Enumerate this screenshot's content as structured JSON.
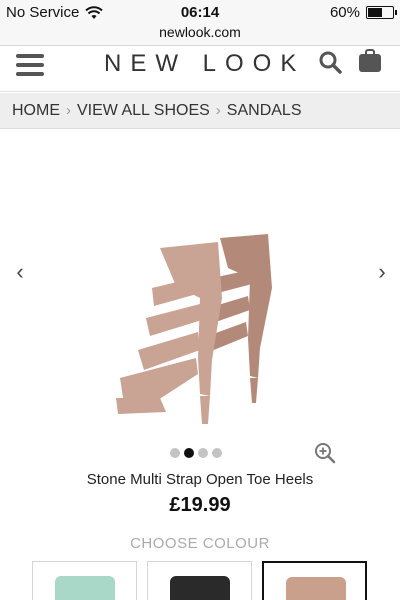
{
  "status_bar": {
    "carrier": "No Service",
    "time": "06:14",
    "battery": "60%",
    "battery_level": 0.6,
    "icons": {
      "wifi": "wifi-icon",
      "battery": "battery-icon"
    }
  },
  "browser": {
    "url": "newlook.com"
  },
  "header": {
    "logo": "NEW LOOK",
    "icons": {
      "menu": "hamburger-menu-icon",
      "search": "search-icon",
      "bag": "shopping-bag-icon"
    }
  },
  "breadcrumb": {
    "items": [
      "HOME",
      "VIEW ALL SHOES",
      "SANDALS"
    ],
    "separator": "›"
  },
  "gallery": {
    "prev_arrow": "‹",
    "next_arrow": "›",
    "image_count": 4,
    "active_index": 1
  },
  "product": {
    "name": "Stone Multi Strap Open Toe Heels",
    "price": "£19.99"
  },
  "colours": {
    "heading": "CHOOSE COLOUR",
    "swatches": [
      {
        "color": "#a9d8c8",
        "selected": false
      },
      {
        "color": "#2a2a2a",
        "selected": false
      },
      {
        "color": "#c9a08c",
        "selected": true
      }
    ]
  },
  "colors": {
    "shoe": "#c9a393",
    "shoe_shadow": "#b38a7a"
  }
}
